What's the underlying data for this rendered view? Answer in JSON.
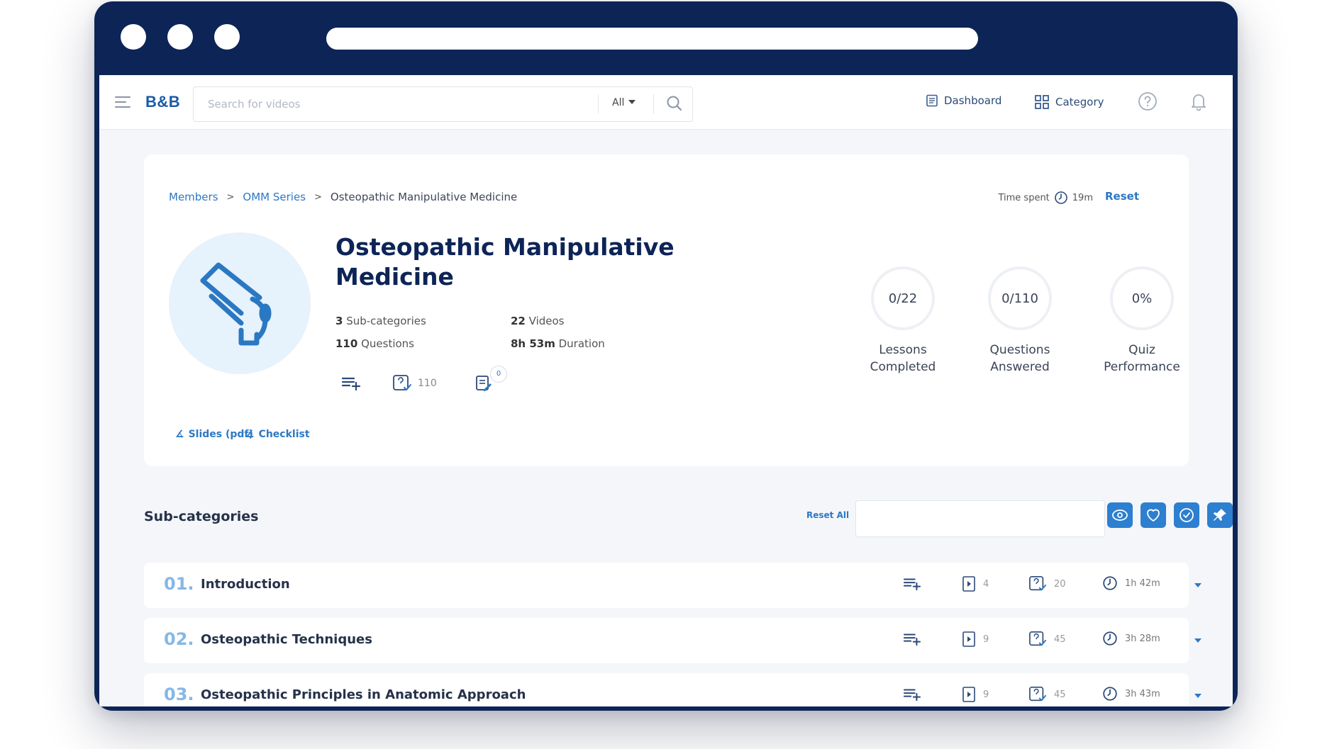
{
  "brand": {
    "logo": "B&B"
  },
  "search": {
    "placeholder": "Search for videos",
    "filter": "All"
  },
  "nav": {
    "dashboard": "Dashboard",
    "category": "Category"
  },
  "breadcrumb": {
    "items": [
      "Members",
      "OMM Series"
    ],
    "current": "Osteopathic Manipulative Medicine"
  },
  "time": {
    "label": "Time spent",
    "value": "19m",
    "reset": "Reset"
  },
  "course": {
    "title": "Osteopathic Manipulative Medicine",
    "subcategories": {
      "num": "3",
      "label": "Sub-categories"
    },
    "videos": {
      "num": "22",
      "label": "Videos"
    },
    "questions": {
      "num": "110",
      "label": "Questions"
    },
    "duration": {
      "num": "8h 53m",
      "label": "Duration"
    },
    "question_count": "110",
    "notes_badge": "0",
    "attachments": [
      "Slides (pdf)",
      "Checklist"
    ]
  },
  "stats": [
    {
      "value": "0/22",
      "label_line1": "Lessons",
      "label_line2": "Completed"
    },
    {
      "value": "0/110",
      "label_line1": "Questions",
      "label_line2": "Answered"
    },
    {
      "value": "0%",
      "label_line1": "Quiz",
      "label_line2": "Performance"
    }
  ],
  "subcats": {
    "heading": "Sub-categories",
    "reset_all": "Reset All",
    "rows": [
      {
        "num": "01.",
        "name": "Introduction",
        "videos": "4",
        "questions": "20",
        "duration": "1h 42m"
      },
      {
        "num": "02.",
        "name": "Osteopathic Techniques",
        "videos": "9",
        "questions": "45",
        "duration": "3h 28m"
      },
      {
        "num": "03.",
        "name": "Osteopathic Principles in Anatomic Approach",
        "videos": "9",
        "questions": "45",
        "duration": "3h 43m"
      }
    ]
  },
  "colors": {
    "frame": "#0d2457",
    "accent": "#2d78c4",
    "button": "#2d7fd0",
    "background": "#f4f6f9"
  }
}
